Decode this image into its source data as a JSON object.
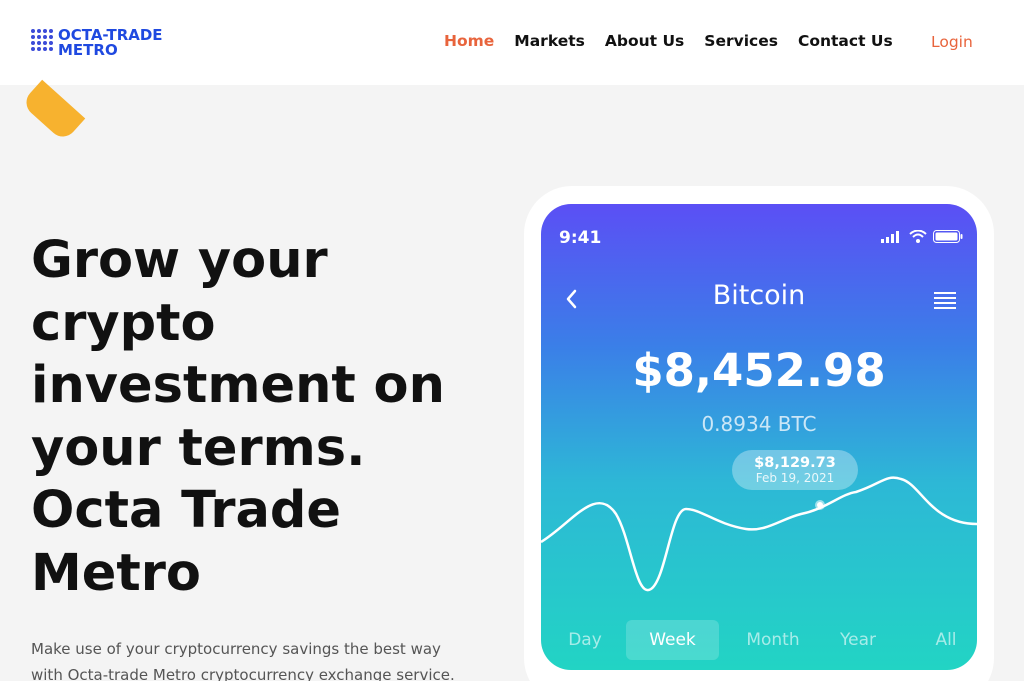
{
  "header": {
    "logo_line1": "OCTA-TRADE",
    "logo_line2": "METRO",
    "nav": [
      "Home",
      "Markets",
      "About Us",
      "Services",
      "Contact Us"
    ],
    "login": "Login"
  },
  "hero": {
    "title_lines": [
      "Grow your",
      "crypto",
      "investment on",
      "your terms.",
      "Octa Trade",
      "Metro"
    ],
    "description_lines": [
      "Make use of your cryptocurrency savings the best way",
      "with Octa-trade Metro cryptocurrency exchange service."
    ]
  },
  "phone": {
    "time": "9:41",
    "coin": "Bitcoin",
    "value": "$8,452.98",
    "btc": "0.8934 BTC",
    "tooltip_price": "$8,129.73",
    "tooltip_date": "Feb 19, 2021",
    "tabs": [
      "Day",
      "Week",
      "Month",
      "Year",
      "All"
    ],
    "active_tab": "Week"
  },
  "colors": {
    "accent": "#e8643c",
    "brand": "#1f49e0",
    "deco": "#f7b22f"
  },
  "icons": [
    "back-chevron-icon",
    "menu-lines-icon",
    "signal-icon",
    "wifi-icon",
    "battery-icon",
    "logo-dots-icon"
  ]
}
